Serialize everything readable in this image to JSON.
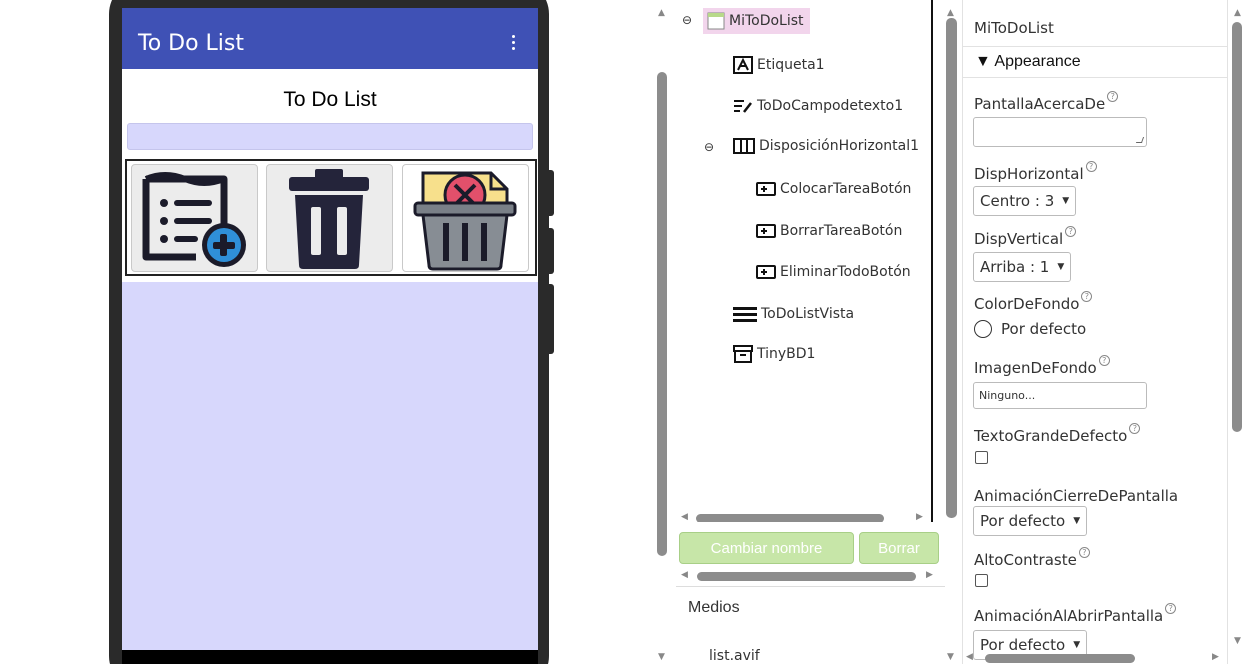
{
  "phone": {
    "app_title": "To Do List",
    "label_text": "To Do List",
    "colors": {
      "appbar": "#3f51b5",
      "screen_bg": "#d7d7fc"
    },
    "buttons": [
      {
        "name": "add-task-image-button",
        "icon": "checklist-add-icon"
      },
      {
        "name": "delete-task-image-button",
        "icon": "trash-icon"
      },
      {
        "name": "delete-all-image-button",
        "icon": "trash-full-icon"
      }
    ]
  },
  "tree": {
    "root": "MiToDoList",
    "items": [
      {
        "label": "Etiqueta1",
        "icon": "label-icon"
      },
      {
        "label": "ToDoCampodetexto1",
        "icon": "textbox-icon"
      },
      {
        "label": "DisposiciónHorizontal1",
        "icon": "horizontal-arrangement-icon"
      },
      {
        "label": "ColocarTareaBotón",
        "icon": "button-icon"
      },
      {
        "label": "BorrarTareaBotón",
        "icon": "button-icon"
      },
      {
        "label": "EliminarTodoBotón",
        "icon": "button-icon"
      },
      {
        "label": "ToDoListVista",
        "icon": "listview-icon"
      },
      {
        "label": "TinyBD1",
        "icon": "tinydb-icon"
      }
    ],
    "rename_button": "Cambiar nombre",
    "delete_button": "Borrar",
    "accent": "#c7e6a8"
  },
  "media": {
    "header": "Medios",
    "file": "list.avif"
  },
  "properties": {
    "component": "MiToDoList",
    "section": "▼ Appearance",
    "about_label": "PantallaAcercaDe",
    "horiz_label": "DispHorizontal",
    "horiz_value": "Centro : 3",
    "vert_label": "DispVertical",
    "vert_value": "Arriba : 1",
    "bg_color_label": "ColorDeFondo",
    "bg_color_value": "Por defecto",
    "bg_image_label": "ImagenDeFondo",
    "bg_image_value": "Ninguno...",
    "big_text_label": "TextoGrandeDefecto",
    "close_anim_label": "AnimaciónCierreDePantalla",
    "close_anim_value": "Por defecto",
    "contrast_label": "AltoContraste",
    "open_anim_label": "AnimaciónAlAbrirPantalla",
    "open_anim_value": "Por defecto"
  }
}
